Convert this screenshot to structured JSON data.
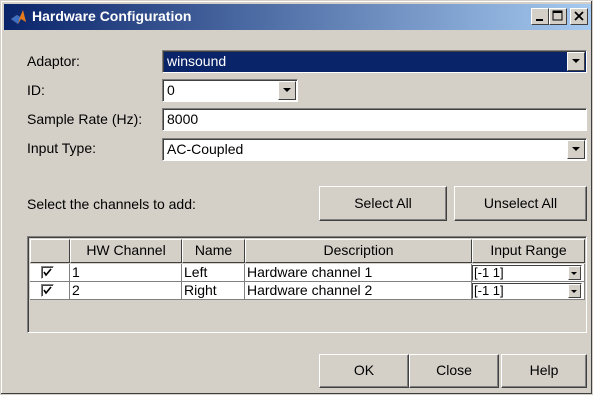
{
  "window": {
    "title": "Hardware Configuration"
  },
  "form": {
    "adaptor_label": "Adaptor:",
    "adaptor_value": "winsound",
    "id_label": "ID:",
    "id_value": "0",
    "sample_rate_label": "Sample Rate (Hz):",
    "sample_rate_value": "8000",
    "input_type_label": "Input Type:",
    "input_type_value": "AC-Coupled"
  },
  "channels": {
    "prompt": "Select the channels to add:",
    "select_all_label": "Select All",
    "unselect_all_label": "Unselect All",
    "columns": [
      "HW Channel",
      "Name",
      "Description",
      "Input Range"
    ],
    "rows": [
      {
        "checked": true,
        "hw_channel": "1",
        "name": "Left",
        "description": "Hardware channel 1",
        "input_range": "[-1 1]"
      },
      {
        "checked": true,
        "hw_channel": "2",
        "name": "Right",
        "description": "Hardware channel 2",
        "input_range": "[-1 1]"
      }
    ]
  },
  "buttons": {
    "ok_label": "OK",
    "close_label": "Close",
    "help_label": "Help"
  },
  "icons": {
    "app": "matlab-logo-icon",
    "minimize": "minimize-icon",
    "maximize": "maximize-icon",
    "close": "close-icon",
    "dropdown": "chevron-down-icon",
    "check": "check-icon"
  },
  "colors": {
    "titlebar_start": "#0a246a",
    "titlebar_end": "#a6caf0",
    "selection": "#0a246a",
    "face": "#d4d0c8"
  }
}
